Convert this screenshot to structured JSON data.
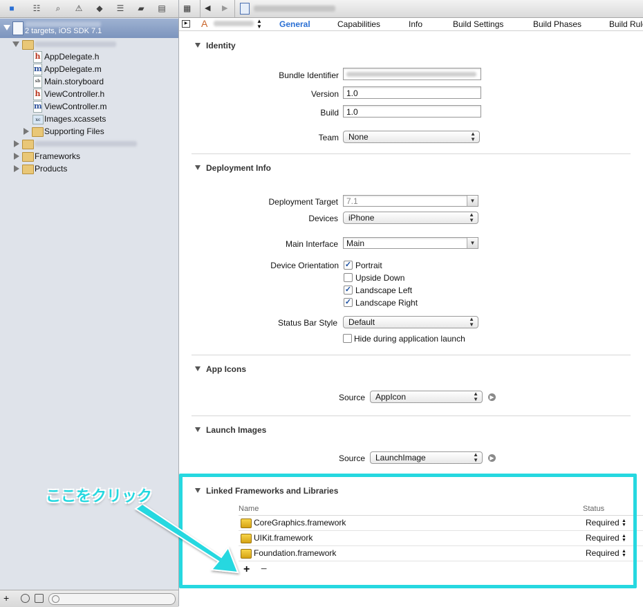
{
  "navigator": {
    "project_subtitle": "2 targets, iOS SDK 7.1",
    "files": [
      "AppDelegate.h",
      "AppDelegate.m",
      "Main.storyboard",
      "ViewController.h",
      "ViewController.m",
      "Images.xcassets"
    ],
    "file_icons": [
      "h",
      "m",
      "sb",
      "h",
      "m",
      "xc"
    ],
    "supporting_files": "Supporting Files",
    "frameworks": "Frameworks",
    "products": "Products",
    "bottom_plus": "+"
  },
  "tabs": [
    "General",
    "Capabilities",
    "Info",
    "Build Settings",
    "Build Phases",
    "Build Rules"
  ],
  "identity": {
    "title": "Identity",
    "bundle_identifier_label": "Bundle Identifier",
    "version_label": "Version",
    "version_value": "1.0",
    "build_label": "Build",
    "build_value": "1.0",
    "team_label": "Team",
    "team_value": "None"
  },
  "deployment": {
    "title": "Deployment Info",
    "target_label": "Deployment Target",
    "target_value": "7.1",
    "devices_label": "Devices",
    "devices_value": "iPhone",
    "main_interface_label": "Main Interface",
    "main_interface_value": "Main",
    "orientation_label": "Device Orientation",
    "orientations": [
      {
        "label": "Portrait",
        "checked": true
      },
      {
        "label": "Upside Down",
        "checked": false
      },
      {
        "label": "Landscape Left",
        "checked": true
      },
      {
        "label": "Landscape Right",
        "checked": true
      }
    ],
    "status_bar_label": "Status Bar Style",
    "status_bar_value": "Default",
    "hide_label": "Hide during application launch"
  },
  "app_icons": {
    "title": "App Icons",
    "source_label": "Source",
    "source_value": "AppIcon"
  },
  "launch_images": {
    "title": "Launch Images",
    "source_label": "Source",
    "source_value": "LaunchImage"
  },
  "linked": {
    "title": "Linked Frameworks and Libraries",
    "col_name": "Name",
    "col_status": "Status",
    "rows": [
      {
        "name": "CoreGraphics.framework",
        "status": "Required"
      },
      {
        "name": "UIKit.framework",
        "status": "Required"
      },
      {
        "name": "Foundation.framework",
        "status": "Required"
      }
    ],
    "add": "+",
    "remove": "−"
  },
  "annotation": {
    "text": "ここをクリック",
    "color": "#26d8e0"
  }
}
